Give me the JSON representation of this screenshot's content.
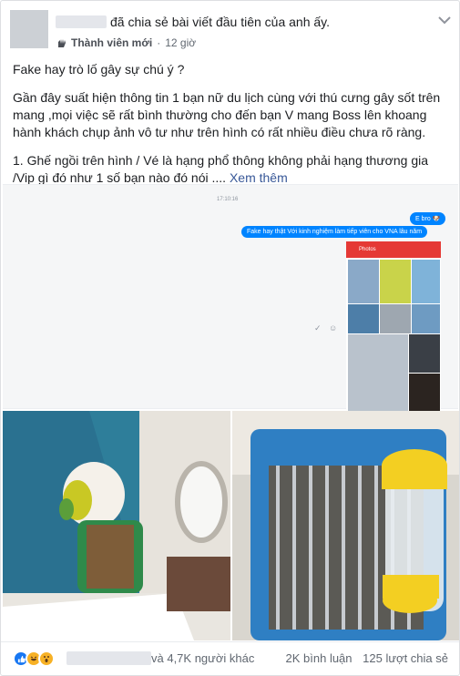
{
  "header": {
    "share_text": "đã chia sẻ bài viết đầu tiên của anh ấy.",
    "badge_label": "Thành viên mới",
    "time": "12 giờ"
  },
  "post": {
    "paragraphs": [
      "Fake hay trò lố gây sự chú ý ?",
      "Gần đây suất hiện thông tin 1 bạn nữ du lịch cùng với thú cưng gây sốt trên mang ,mọi việc sẽ rất bình thường cho đến bạn V mang Boss lên khoang hành khách chụp ảnh vô tư như trên hình có rất nhiều điều chưa rõ ràng.",
      "1. Ghế ngồi trên hình / Vé là hạng phổ thông không phải hạng thương gia /Vip gì đó như 1 số bạn nào đó nói ...."
    ],
    "see_more": "Xem thêm"
  },
  "screenshot": {
    "timestamp": "17:10:16",
    "messages": [
      "E bro 🐶",
      "Fake hay thật Với kinh nghiệm làm tiếp viên cho VNA lâu năm"
    ],
    "photos_title": "Photos"
  },
  "footer": {
    "others": "và 4,7K người khác",
    "comments": "2K bình luận",
    "shares": "125 lượt chia sẻ"
  },
  "colors": {
    "link": "#385898",
    "like": "#1877f2",
    "haha": "#f7b125",
    "messenger": "#0084ff"
  }
}
